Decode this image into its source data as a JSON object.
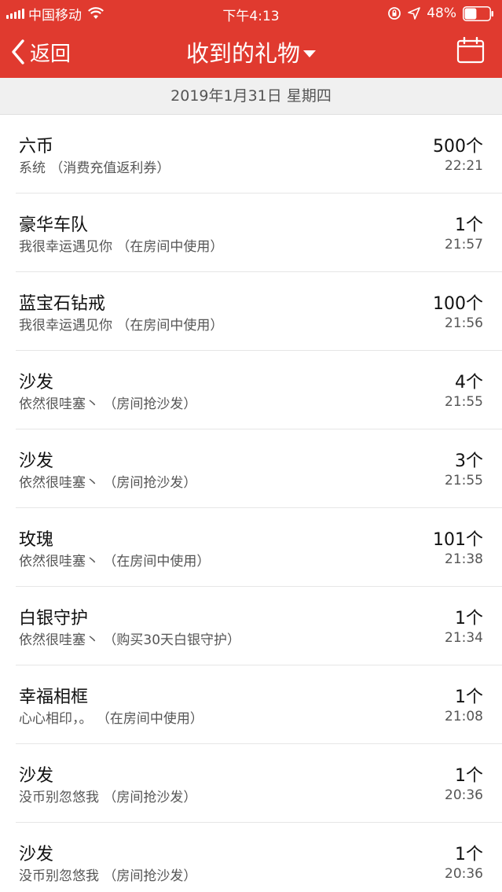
{
  "status_bar": {
    "carrier": "中国移动",
    "time": "下午4:13",
    "battery": "48%",
    "battery_level": 0.48
  },
  "nav": {
    "back_label": "返回",
    "title": "收到的礼物"
  },
  "date_header": "2019年1月31日  星期四",
  "gifts": [
    {
      "name": "六币",
      "sub": "系统 （消费充值返利券）",
      "count": "500个",
      "time": "22:21"
    },
    {
      "name": "豪华车队",
      "sub": "我很幸运遇见你 （在房间中使用）",
      "count": "1个",
      "time": "21:57"
    },
    {
      "name": "蓝宝石钻戒",
      "sub": "我很幸运遇见你 （在房间中使用）",
      "count": "100个",
      "time": "21:56"
    },
    {
      "name": "沙发",
      "sub": "依然很哇塞丶 （房间抢沙发）",
      "count": "4个",
      "time": "21:55"
    },
    {
      "name": "沙发",
      "sub": "依然很哇塞丶 （房间抢沙发）",
      "count": "3个",
      "time": "21:55"
    },
    {
      "name": "玫瑰",
      "sub": "依然很哇塞丶 （在房间中使用）",
      "count": "101个",
      "time": "21:38"
    },
    {
      "name": "白银守护",
      "sub": "依然很哇塞丶 （购买30天白银守护）",
      "count": "1个",
      "time": "21:34"
    },
    {
      "name": "幸福相框",
      "sub": "心心相印，。 （在房间中使用）",
      "count": "1个",
      "time": "21:08"
    },
    {
      "name": "沙发",
      "sub": "没币别忽悠我 （房间抢沙发）",
      "count": "1个",
      "time": "20:36"
    },
    {
      "name": "沙发",
      "sub": "没币别忽悠我 （房间抢沙发）",
      "count": "1个",
      "time": "20:36"
    }
  ],
  "colors": {
    "header_bg": "#e03a2f",
    "date_bar_bg": "#f0f0f0"
  }
}
